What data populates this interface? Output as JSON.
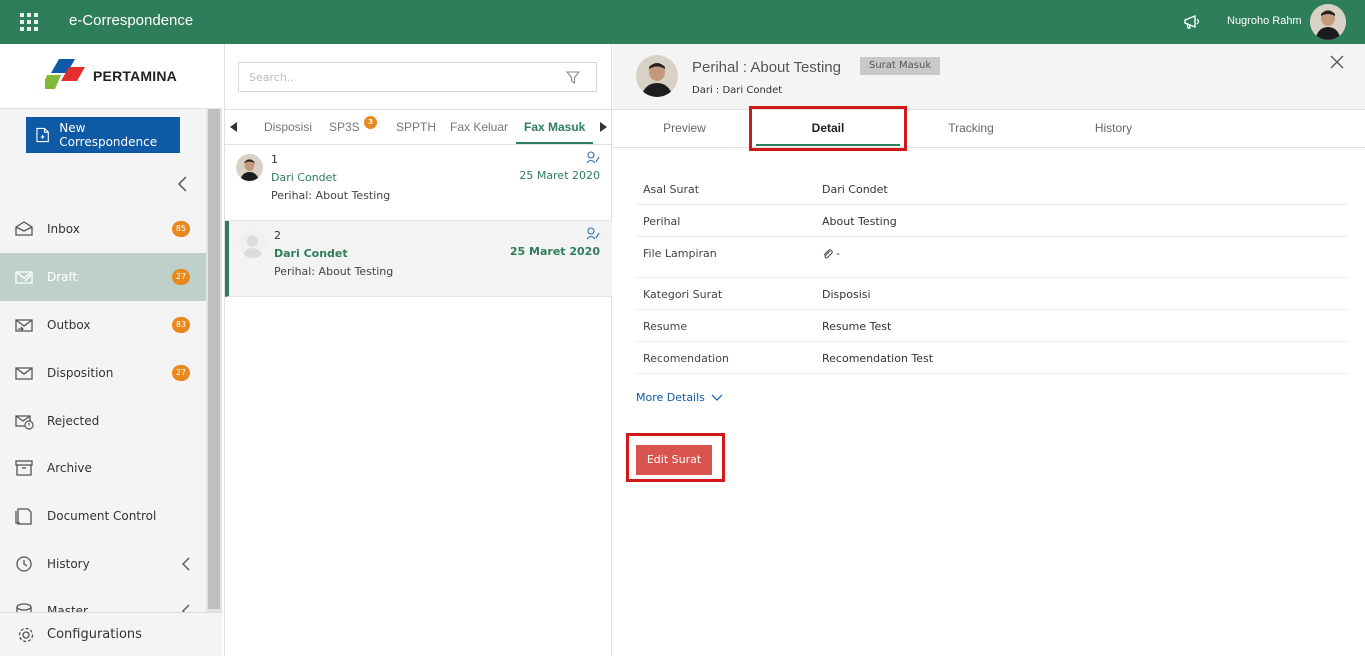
{
  "header": {
    "app_title": "e-Correspondence",
    "user_name": "Nugroho Rahm",
    "icons": [
      "apps-grid-icon",
      "megaphone-icon",
      "user-avatar"
    ],
    "brand_color": "#2e7d5b"
  },
  "sidebar": {
    "logo_text": "PERTAMINA",
    "new_button_label": "New Correspondence",
    "items": [
      {
        "label": "Inbox",
        "badge": "85",
        "icon": "inbox-icon"
      },
      {
        "label": "Draft",
        "badge": "27",
        "icon": "draft-icon",
        "active": true
      },
      {
        "label": "Outbox",
        "badge": "83",
        "icon": "outbox-icon"
      },
      {
        "label": "Disposition",
        "badge": "27",
        "icon": "disposition-icon"
      },
      {
        "label": "Rejected",
        "badge": "",
        "icon": "rejected-icon"
      },
      {
        "label": "Archive",
        "badge": "",
        "icon": "archive-icon"
      },
      {
        "label": "Document Control",
        "badge": "",
        "icon": "document-control-icon"
      },
      {
        "label": "History",
        "badge": "",
        "icon": "history-icon"
      },
      {
        "label": "Master",
        "badge": "",
        "icon": "master-icon"
      }
    ],
    "config_label": "Configurations"
  },
  "list": {
    "search_placeholder": "Search..",
    "tabs": [
      {
        "label": "Disposisi"
      },
      {
        "label": "SP3S",
        "badge": "3"
      },
      {
        "label": "SPPTH"
      },
      {
        "label": "Fax Keluar"
      },
      {
        "label": "Fax Masuk",
        "active": true
      }
    ],
    "items": [
      {
        "num": "1",
        "sender": "Dari Condet",
        "subject": "Perihal: About Testing",
        "date": "25 Maret 2020"
      },
      {
        "num": "2",
        "sender": "Dari Condet",
        "subject": "Perihal: About Testing",
        "date": "25 Maret 2020"
      }
    ]
  },
  "detail": {
    "title": "Perihal : About Testing",
    "tag": "Surat Masuk",
    "from": "Dari : Dari Condet",
    "tabs": [
      "Preview",
      "Detail",
      "Tracking",
      "History"
    ],
    "active_tab": "Detail",
    "rows": [
      {
        "label": "Asal Surat",
        "value": "Dari Condet"
      },
      {
        "label": "Perihal",
        "value": "About Testing"
      },
      {
        "label": "File Lampiran",
        "value": "-"
      },
      {
        "label": "Kategori Surat",
        "value": "Disposisi"
      },
      {
        "label": "Resume",
        "value": "Resume Test"
      },
      {
        "label": "Recomendation",
        "value": "Recomendation Test"
      }
    ],
    "more_label": "More Details",
    "edit_label": "Edit Surat"
  }
}
